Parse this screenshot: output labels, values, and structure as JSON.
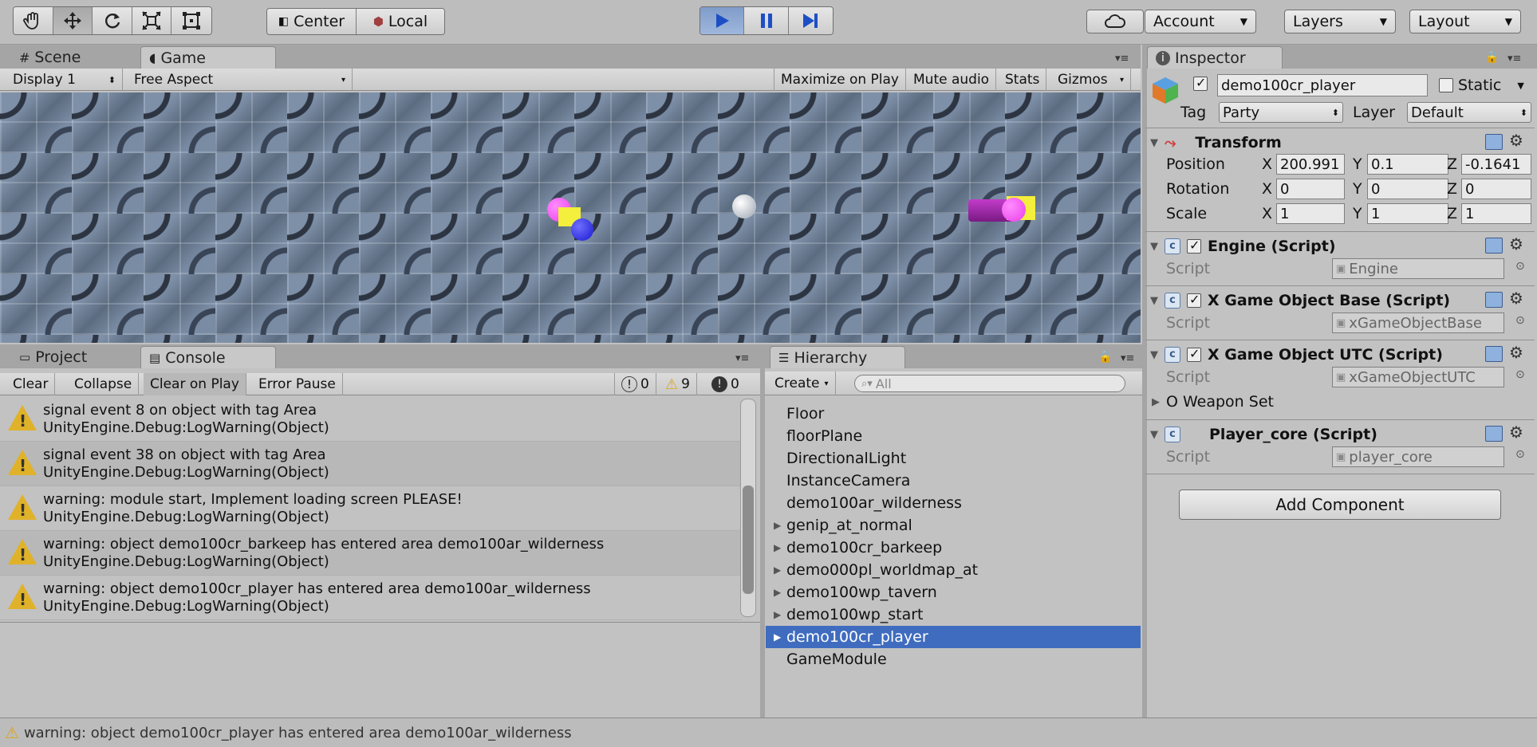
{
  "toolbar": {
    "pivot_label": "Center",
    "space_label": "Local",
    "account_label": "Account",
    "layers_label": "Layers",
    "layout_label": "Layout"
  },
  "game_panel": {
    "tab_scene": "Scene",
    "tab_game": "Game",
    "display": "Display 1",
    "aspect": "Free Aspect",
    "maximize": "Maximize on Play",
    "mute": "Mute audio",
    "stats": "Stats",
    "gizmos": "Gizmos"
  },
  "console": {
    "tab_project": "Project",
    "tab_console": "Console",
    "clear": "Clear",
    "collapse": "Collapse",
    "clear_on_play": "Clear on Play",
    "error_pause": "Error Pause",
    "count_info": "0",
    "count_warn": "9",
    "count_error": "0",
    "entries": [
      {
        "line1": "signal event 8 on object with tag Area",
        "line2": "UnityEngine.Debug:LogWarning(Object)"
      },
      {
        "line1": "signal event 38 on object with tag Area",
        "line2": "UnityEngine.Debug:LogWarning(Object)"
      },
      {
        "line1": "warning: module start, Implement loading screen PLEASE!",
        "line2": "UnityEngine.Debug:LogWarning(Object)"
      },
      {
        "line1": "warning: object demo100cr_barkeep has entered area demo100ar_wilderness",
        "line2": "UnityEngine.Debug:LogWarning(Object)"
      },
      {
        "line1": "warning: object demo100cr_player has entered area demo100ar_wilderness",
        "line2": "UnityEngine.Debug:LogWarning(Object)"
      }
    ]
  },
  "hierarchy": {
    "tab": "Hierarchy",
    "create": "Create",
    "search_placeholder": "All",
    "items": [
      {
        "label": "Floor",
        "expandable": false
      },
      {
        "label": "floorPlane",
        "expandable": false
      },
      {
        "label": "DirectionalLight",
        "expandable": false
      },
      {
        "label": "InstanceCamera",
        "expandable": false
      },
      {
        "label": "demo100ar_wilderness",
        "expandable": false
      },
      {
        "label": "genip_at_normal",
        "expandable": true
      },
      {
        "label": "demo100cr_barkeep",
        "expandable": true
      },
      {
        "label": "demo000pl_worldmap_at",
        "expandable": true
      },
      {
        "label": "demo100wp_tavern",
        "expandable": true
      },
      {
        "label": "demo100wp_start",
        "expandable": true
      },
      {
        "label": "demo100cr_player",
        "expandable": true,
        "selected": true
      },
      {
        "label": "GameModule",
        "expandable": false
      }
    ]
  },
  "inspector": {
    "tab": "Inspector",
    "object_name": "demo100cr_player",
    "static_label": "Static",
    "tag_label": "Tag",
    "tag_value": "Party",
    "layer_label": "Layer",
    "layer_value": "Default",
    "transform": {
      "title": "Transform",
      "position_label": "Position",
      "rotation_label": "Rotation",
      "scale_label": "Scale",
      "position": {
        "x": "200.991",
        "y": "0.1",
        "z": "-0.1641"
      },
      "rotation": {
        "x": "0",
        "y": "0",
        "z": "0"
      },
      "scale": {
        "x": "1",
        "y": "1",
        "z": "1"
      }
    },
    "script_label": "Script",
    "components": [
      {
        "title": "Engine (Script)",
        "script": "Engine"
      },
      {
        "title": "X Game Object Base (Script)",
        "script": "xGameObjectBase"
      },
      {
        "title": "X Game Object UTC (Script)",
        "script": "xGameObjectUTC"
      },
      {
        "title": "Player_core (Script)",
        "script": "player_core"
      }
    ],
    "weapon_set": "O Weapon Set",
    "add_component": "Add Component"
  },
  "status_bar": {
    "message": "warning: object demo100cr_player has entered area demo100ar_wilderness"
  }
}
